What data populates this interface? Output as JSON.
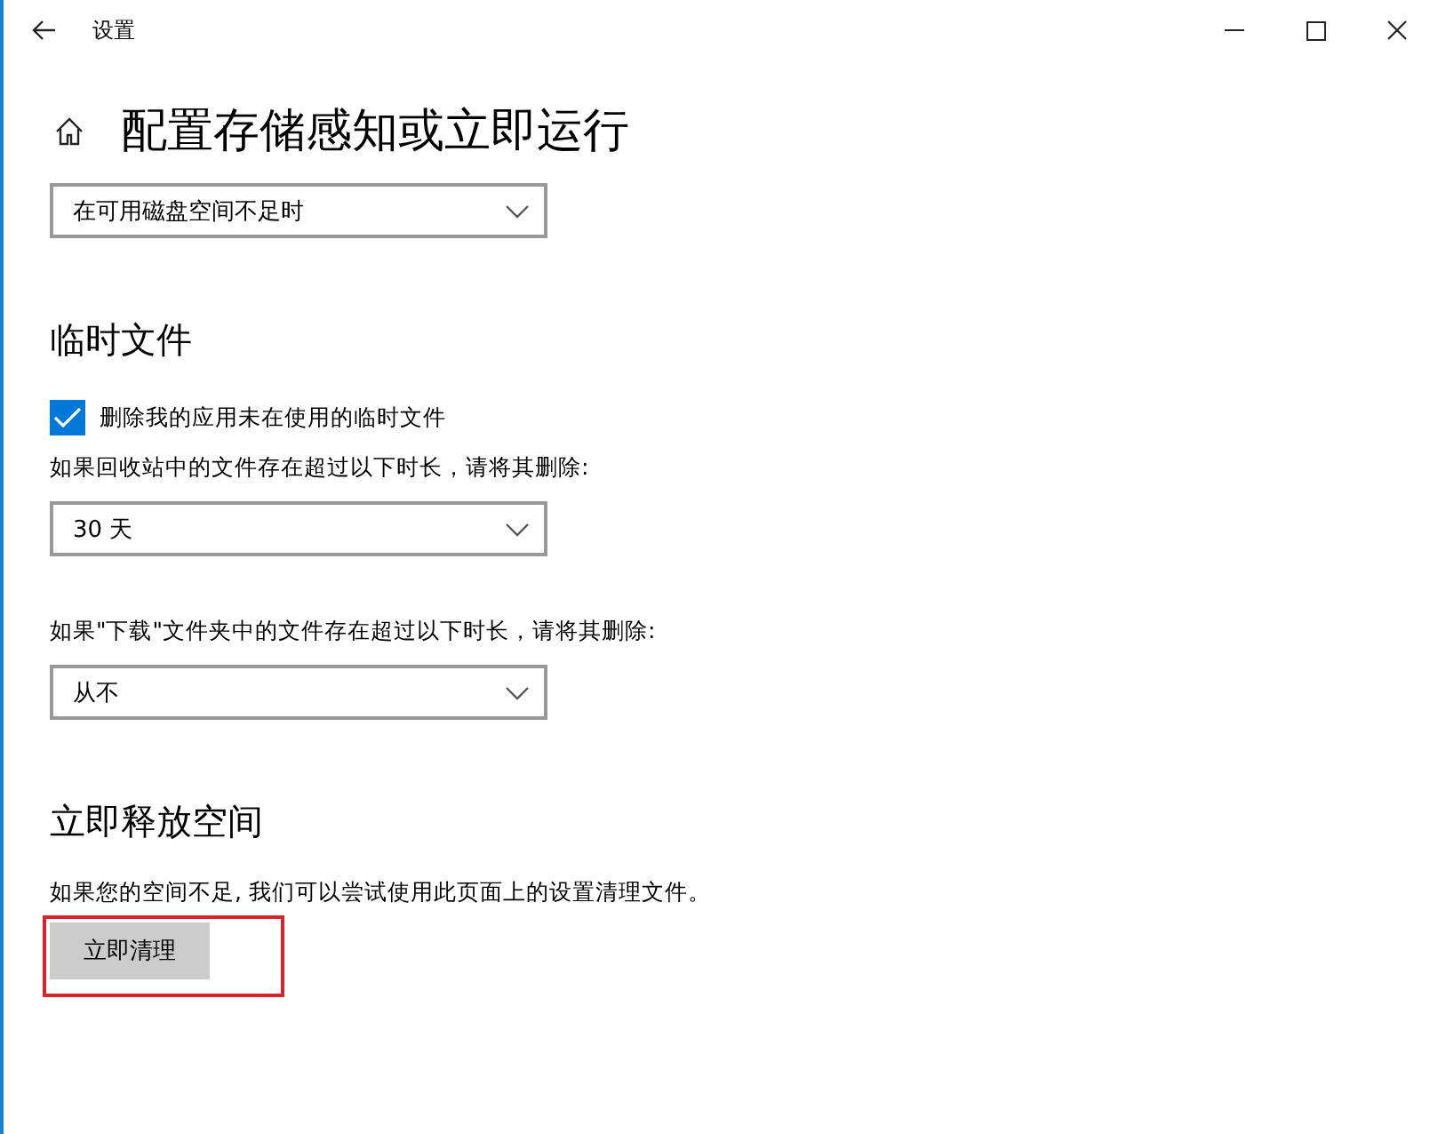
{
  "window": {
    "title": "设置"
  },
  "page": {
    "title": "配置存储感知或立即运行"
  },
  "sections": [
    {
      "items": [
        {
          "kind": "dropdown",
          "value": "在可用磁盘空间不足时"
        }
      ]
    },
    {
      "heading": "临时文件",
      "items": [
        {
          "kind": "checkbox",
          "label": "删除我的应用未在使用的临时文件",
          "checked": true
        },
        {
          "kind": "label",
          "text": "如果回收站中的文件存在超过以下时长，请将其删除:"
        },
        {
          "kind": "dropdown",
          "value": "30 天"
        },
        {
          "kind": "label",
          "text": "如果\"下载\"文件夹中的文件存在超过以下时长，请将其删除:"
        },
        {
          "kind": "dropdown",
          "value": "从不"
        }
      ]
    },
    {
      "heading": "立即释放空间",
      "items": [
        {
          "kind": "label",
          "text": "如果您的空间不足, 我们可以尝试使用此页面上的设置清理文件。"
        },
        {
          "kind": "button",
          "label": "立即清理",
          "highlighted": true
        }
      ]
    }
  ]
}
